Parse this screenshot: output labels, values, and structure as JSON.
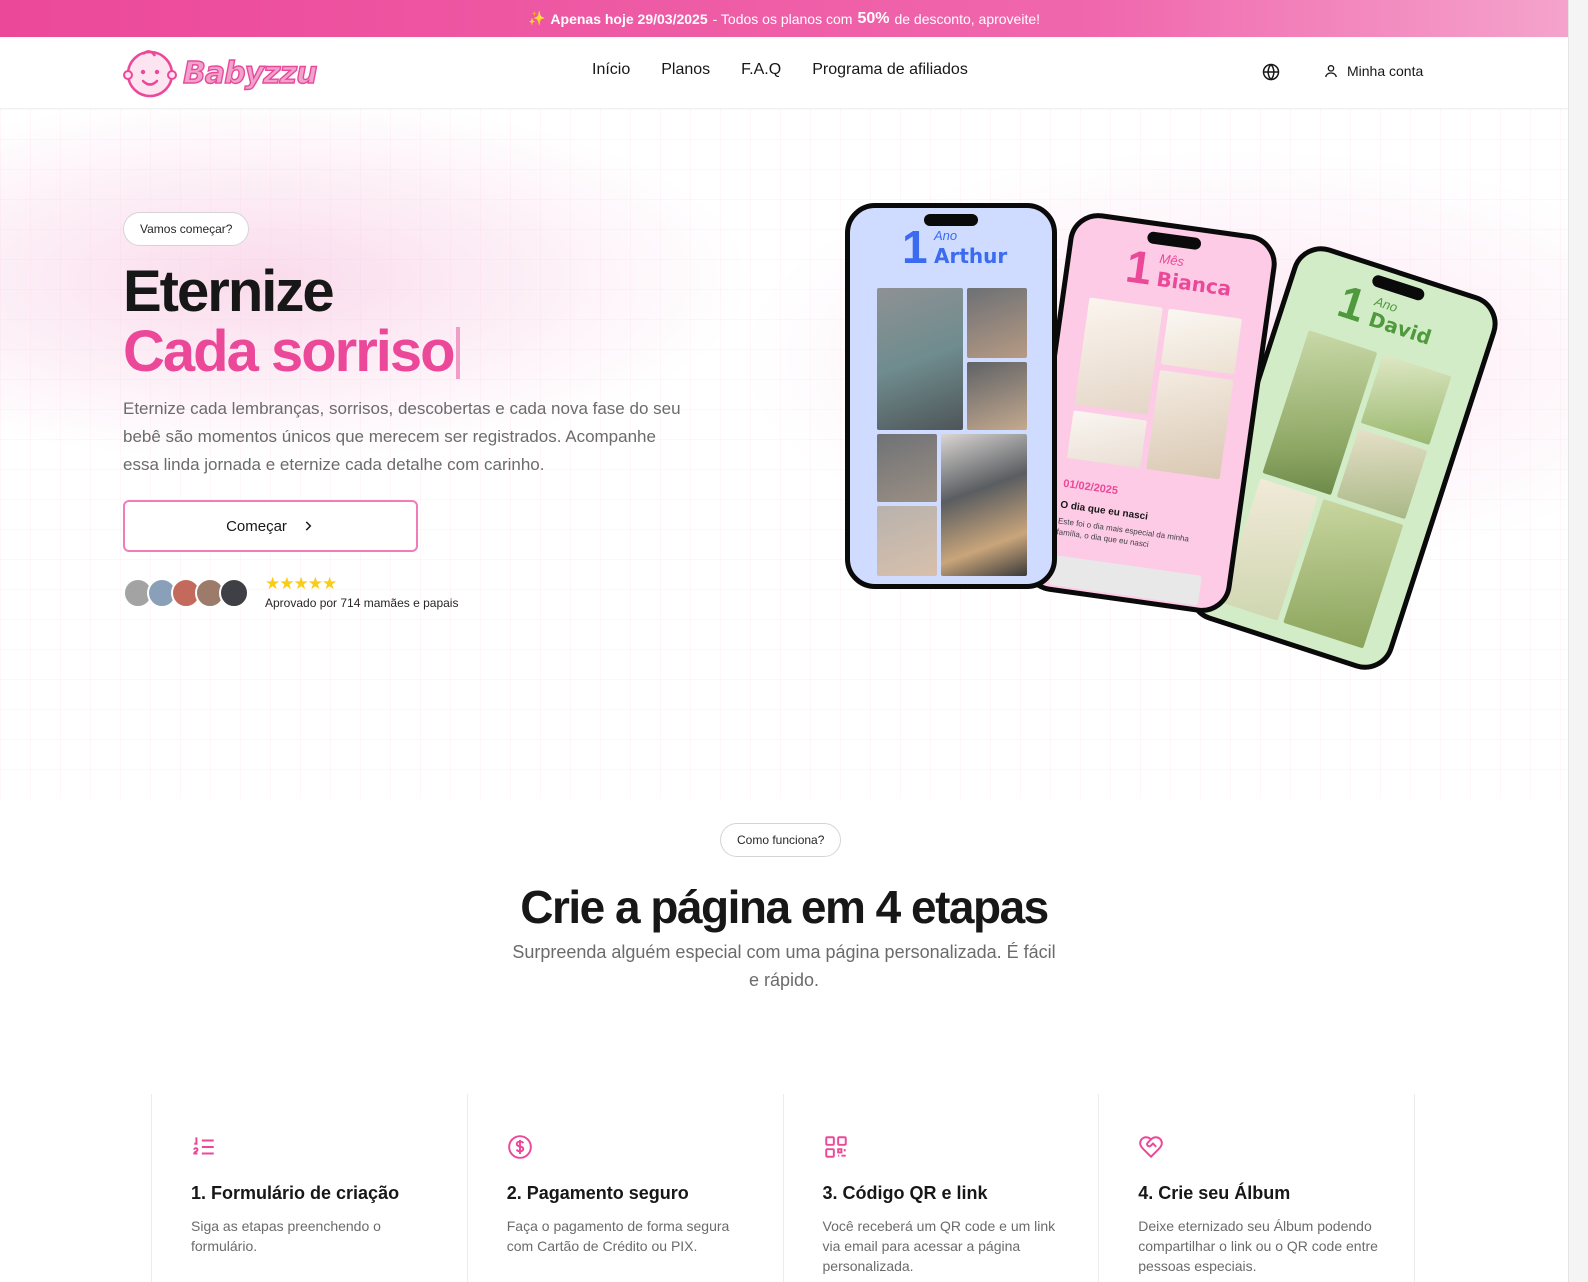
{
  "promo": {
    "emoji": "✨",
    "lead": "Apenas hoje 29/03/2025",
    "text_before": "- Todos os planos com",
    "discount": "50%",
    "text_after": "de desconto, aproveite!"
  },
  "header": {
    "logo_text": "Babyzzu",
    "nav": [
      "Início",
      "Planos",
      "F.A.Q",
      "Programa de afiliados"
    ],
    "account_label": "Minha conta"
  },
  "hero": {
    "badge": "Vamos começar?",
    "title_line1": "Eternize",
    "title_line2": "Cada sorriso",
    "description": "Eternize cada lembranças, sorrisos, descobertas e cada nova fase do seu bebê são momentos únicos que merecem ser registrados. Acompanhe essa linda jornada e eternize cada detalhe com carinho.",
    "cta_label": "Começar",
    "rating_stars": "★★★★★",
    "approved_text": "Aprovado por 714 mamães e papais",
    "avatar_colors": [
      "#a3a3a3",
      "#8aa0b8",
      "#c46a5c",
      "#9c7b6b",
      "#3f3f46"
    ]
  },
  "phones": [
    {
      "number": "1",
      "unit": "Ano",
      "name": "Arthur",
      "bg": "#cfdcff",
      "accent": "#3b6cf0"
    },
    {
      "number": "1",
      "unit": "Mês",
      "name": "Bianca",
      "bg": "#fdcbe5",
      "accent": "#ec4899",
      "date": "01/02/2025",
      "caption_title": "O dia que eu nasci",
      "caption_text": "Este foi o dia mais especial da minha família, o dia que eu nasci"
    },
    {
      "number": "1",
      "unit": "Ano",
      "name": "David",
      "bg": "#d3ecc8",
      "accent": "#4f9a3c"
    }
  ],
  "how": {
    "badge": "Como funciona?",
    "title": "Crie a página em 4 etapas",
    "subtitle": "Surpreenda alguém especial com uma página personalizada. É fácil e rápido.",
    "steps": [
      {
        "icon": "list-ordered-icon",
        "title": "1. Formulário de criação",
        "text": "Siga as etapas preenchendo o formulário."
      },
      {
        "icon": "dollar-circle-icon",
        "title": "2. Pagamento seguro",
        "text": "Faça o pagamento de forma segura com Cartão de Crédito ou PIX."
      },
      {
        "icon": "qr-code-icon",
        "title": "3. Código QR e link",
        "text": "Você receberá um QR code e um link via email para acessar a página personalizada."
      },
      {
        "icon": "heart-handshake-icon",
        "title": "4. Crie seu Álbum",
        "text": "Deixe eternizado seu Álbum podendo compartilhar o link ou o QR code entre pessoas especiais."
      }
    ]
  },
  "colors": {
    "brand": "#ec4899",
    "text": "#171717",
    "muted": "#6b6b6b"
  }
}
